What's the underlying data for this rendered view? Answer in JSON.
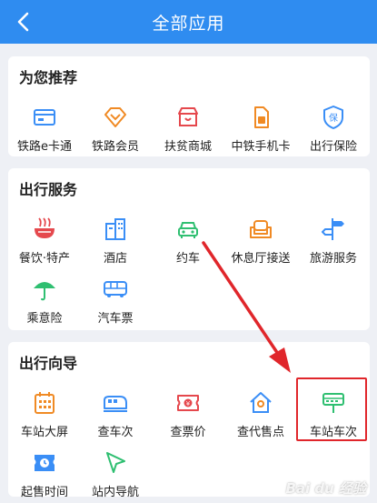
{
  "header": {
    "title": "全部应用"
  },
  "sections": [
    {
      "title": "为您推荐",
      "items": [
        {
          "label": "铁路e卡通",
          "icon": "card-icon"
        },
        {
          "label": "铁路会员",
          "icon": "diamond-icon"
        },
        {
          "label": "扶贫商城",
          "icon": "shop-icon"
        },
        {
          "label": "中铁手机卡",
          "icon": "sim-card-icon"
        },
        {
          "label": "出行保险",
          "icon": "insurance-shield-icon"
        }
      ]
    },
    {
      "title": "出行服务",
      "items": [
        {
          "label": "餐饮·特产",
          "icon": "noodle-bowl-icon"
        },
        {
          "label": "酒店",
          "icon": "hotel-icon"
        },
        {
          "label": "约车",
          "icon": "car-icon"
        },
        {
          "label": "休息厅接送",
          "icon": "sofa-icon"
        },
        {
          "label": "旅游服务",
          "icon": "signpost-icon"
        },
        {
          "label": "乘意险",
          "icon": "umbrella-icon"
        },
        {
          "label": "汽车票",
          "icon": "bus-icon"
        }
      ]
    },
    {
      "title": "出行向导",
      "items": [
        {
          "label": "车站大屏",
          "icon": "calendar-grid-icon"
        },
        {
          "label": "查车次",
          "icon": "train-icon"
        },
        {
          "label": "查票价",
          "icon": "ticket-price-icon"
        },
        {
          "label": "查代售点",
          "icon": "house-location-icon"
        },
        {
          "label": "车站车次",
          "icon": "station-train-icon"
        },
        {
          "label": "起售时间",
          "icon": "clock-ticket-icon"
        },
        {
          "label": "站内导航",
          "icon": "navigation-arrow-icon"
        }
      ]
    }
  ],
  "colors": {
    "header": "#2f8cf0",
    "icon_blue": "#3a8ef6",
    "icon_orange": "#f08a24",
    "icon_red": "#e5484d",
    "icon_green": "#2fbf71",
    "highlight": "#e0262b"
  },
  "watermark": {
    "text": "Bai du 经验"
  }
}
